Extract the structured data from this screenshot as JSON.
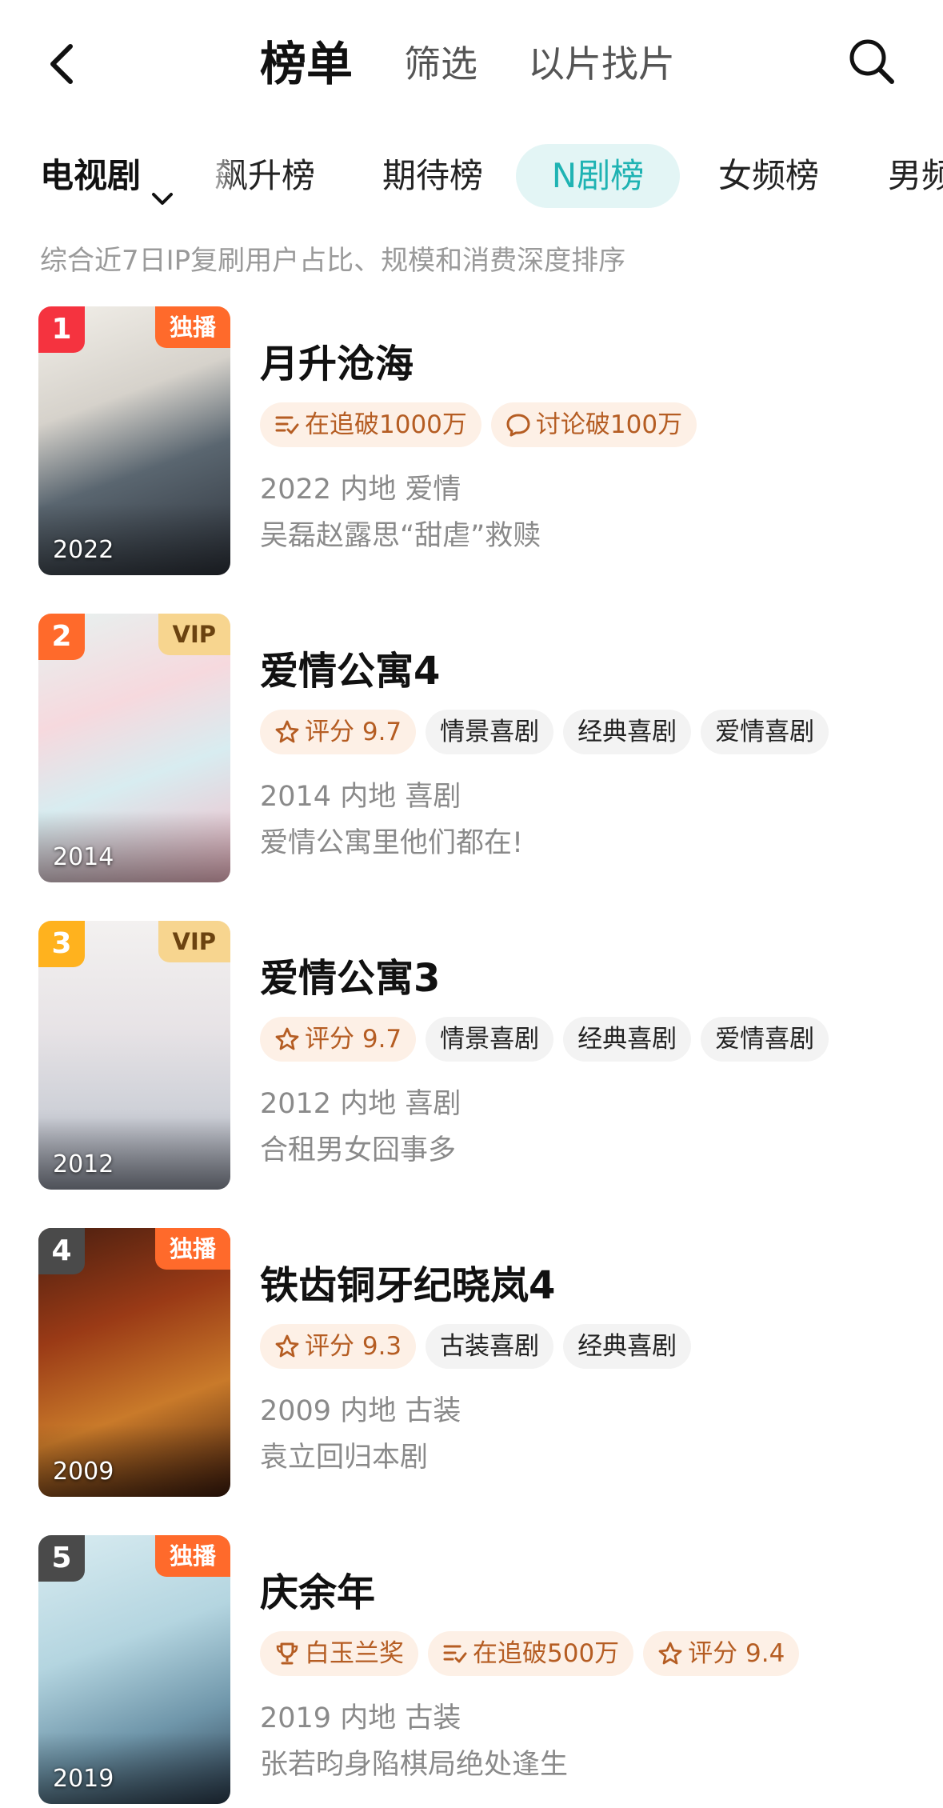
{
  "header": {
    "tabs": [
      "榜单",
      "筛选",
      "以片找片"
    ]
  },
  "category": {
    "dropdown_label": "电视剧",
    "tabs": [
      "飙升榜",
      "期待榜",
      "N剧榜",
      "女频榜",
      "男频"
    ],
    "active_tab": "N剧榜"
  },
  "subtitle": "综合近7日IP复刷用户占比、规模和消费深度排序",
  "colors": {
    "accent": "#1fb3b3",
    "accent_bg": "#e3f5f5",
    "rank1": "#f5333f",
    "rank2": "#ff6a2b",
    "rank3": "#ffb21e",
    "rank_other": "#4a4a4a",
    "badge_exclusive": "#ff6a2b",
    "badge_vip": "#f7d58f"
  },
  "items": [
    {
      "rank": "1",
      "badge": "独播",
      "badge_type": "exclusive",
      "poster_year": "2022",
      "title": "月升沧海",
      "tags": [
        {
          "icon": "follow-list-icon",
          "text": "在追破1000万",
          "style": "highlight"
        },
        {
          "icon": "comment-icon",
          "text": "讨论破100万",
          "style": "highlight"
        }
      ],
      "meta": "2022 内地 爱情",
      "desc": "吴磊赵露思“甜虐”救赎"
    },
    {
      "rank": "2",
      "badge": "VIP",
      "badge_type": "vip",
      "poster_year": "2014",
      "title": "爱情公寓4",
      "tags": [
        {
          "icon": "star-icon",
          "text": "评分 9.7",
          "style": "highlight"
        },
        {
          "icon": "",
          "text": "情景喜剧",
          "style": "plain"
        },
        {
          "icon": "",
          "text": "经典喜剧",
          "style": "plain"
        },
        {
          "icon": "",
          "text": "爱情喜剧",
          "style": "plain"
        }
      ],
      "meta": "2014 内地 喜剧",
      "desc": "爱情公寓里他们都在!"
    },
    {
      "rank": "3",
      "badge": "VIP",
      "badge_type": "vip",
      "poster_year": "2012",
      "title": "爱情公寓3",
      "tags": [
        {
          "icon": "star-icon",
          "text": "评分 9.7",
          "style": "highlight"
        },
        {
          "icon": "",
          "text": "情景喜剧",
          "style": "plain"
        },
        {
          "icon": "",
          "text": "经典喜剧",
          "style": "plain"
        },
        {
          "icon": "",
          "text": "爱情喜剧",
          "style": "plain"
        }
      ],
      "meta": "2012 内地 喜剧",
      "desc": "合租男女囧事多"
    },
    {
      "rank": "4",
      "badge": "独播",
      "badge_type": "exclusive",
      "poster_year": "2009",
      "title": "铁齿铜牙纪晓岚4",
      "tags": [
        {
          "icon": "star-icon",
          "text": "评分 9.3",
          "style": "highlight"
        },
        {
          "icon": "",
          "text": "古装喜剧",
          "style": "plain"
        },
        {
          "icon": "",
          "text": "经典喜剧",
          "style": "plain"
        }
      ],
      "meta": "2009 内地 古装",
      "desc": "袁立回归本剧"
    },
    {
      "rank": "5",
      "badge": "独播",
      "badge_type": "exclusive",
      "poster_year": "2019",
      "title": "庆余年",
      "tags": [
        {
          "icon": "trophy-icon",
          "text": "白玉兰奖",
          "style": "highlight"
        },
        {
          "icon": "follow-list-icon",
          "text": "在追破500万",
          "style": "highlight"
        },
        {
          "icon": "star-icon",
          "text": "评分 9.4",
          "style": "highlight"
        }
      ],
      "meta": "2019 内地 古装",
      "desc": "张若昀身陷棋局绝处逢生"
    }
  ]
}
